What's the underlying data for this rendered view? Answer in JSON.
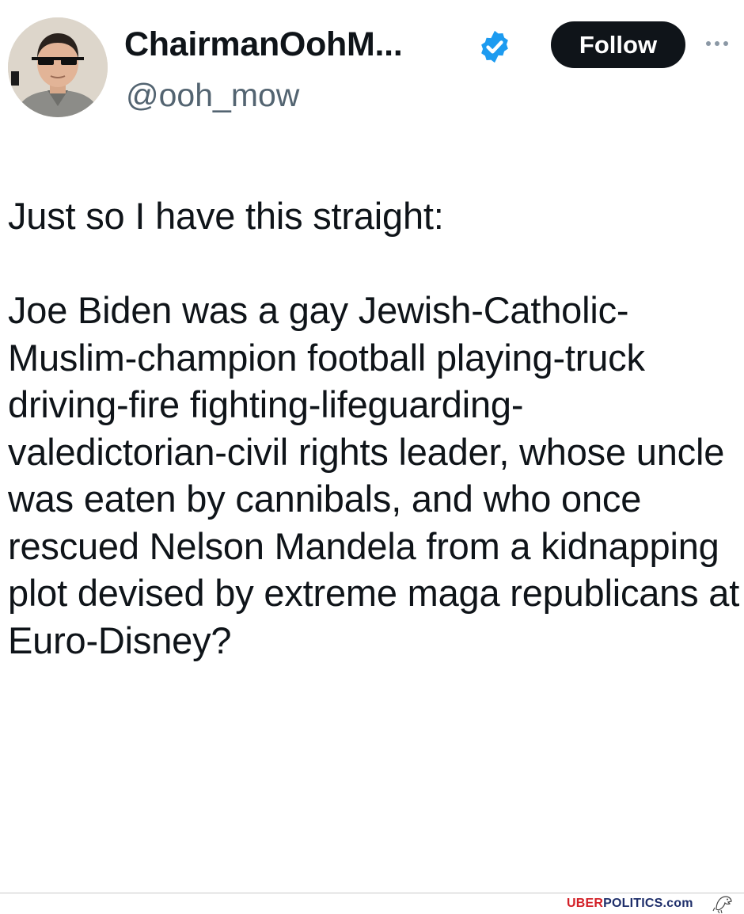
{
  "tweet": {
    "author": {
      "display_name": "ChairmanOohM...",
      "handle": "@ooh_mow",
      "verified": true,
      "avatar_icon": "profile-portrait-with-sunglasses"
    },
    "follow_label": "Follow",
    "more_icon": "more-horizontal-icon",
    "paragraphs": [
      "Just so I have this straight:",
      "Joe Biden was a gay Jewish-Catholic-Muslim-champion football playing-truck driving-fire fighting-lifeguarding-valedictorian-civil rights leader, whose uncle was eaten by cannibals, and who once rescued Nelson Mandela from a kidnapping plot devised by extreme maga republicans at Euro-Disney?"
    ]
  },
  "watermark": {
    "part1": "UBER",
    "part2": "POLITICS",
    "part3": ".com",
    "icon": "eagle-icon"
  },
  "colors": {
    "text": "#0f1419",
    "secondary_text": "#536471",
    "verified_blue": "#1d9bf0",
    "follow_button_bg": "#0f1419",
    "watermark_red": "#d32027",
    "watermark_blue": "#1f2f6b"
  }
}
